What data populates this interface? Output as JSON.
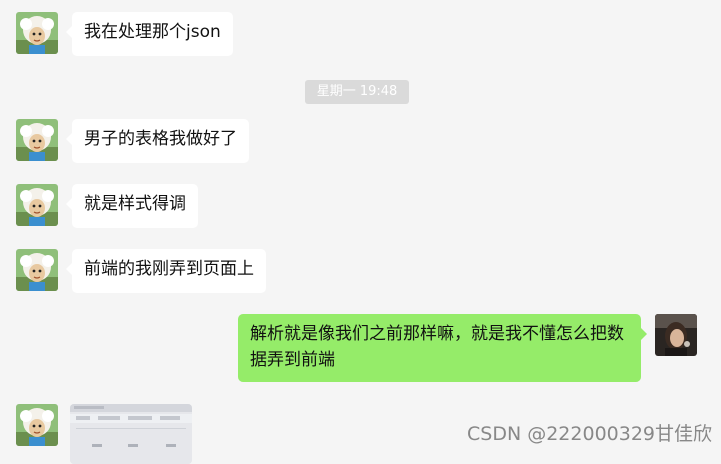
{
  "conversation": {
    "messages": [
      {
        "side": "in",
        "text": "我在处理那个json"
      },
      {
        "side": "in",
        "text": "男子的表格我做好了"
      },
      {
        "side": "in",
        "text": "就是样式得调"
      },
      {
        "side": "in",
        "text": "前端的我刚弄到页面上"
      },
      {
        "side": "out",
        "text": "解析就是像我们之前那样嘛，就是我不懂怎么把数据弄到前端"
      }
    ],
    "timestamp": "星期一 19:48"
  },
  "image_thumbnail": {
    "icon": "screenshot-image-thumbnail"
  },
  "watermark": "CSDN @222000329甘佳欣",
  "colors": {
    "background": "#f5f5f5",
    "incoming_bubble": "#ffffff",
    "outgoing_bubble": "#95ec69",
    "timestamp_bg": "#dadada"
  }
}
